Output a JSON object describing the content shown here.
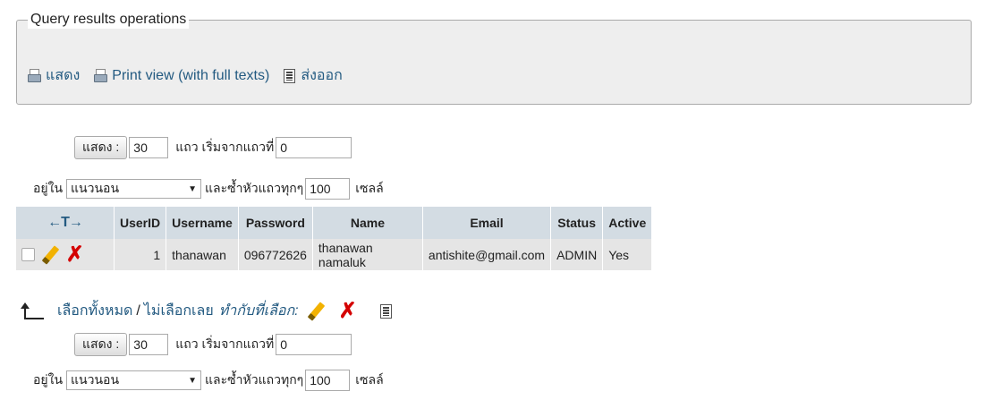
{
  "ops": {
    "legend": "Query results operations",
    "show_label": "แสดง",
    "print_label": "Print view (with full texts)",
    "export_label": "ส่งออก"
  },
  "nav": {
    "show_button": "แสดง :",
    "rows_value": "30",
    "rows_text": "แถว เริ่มจากแถวที่",
    "start_value": "0",
    "in_label": "อยู่ใน",
    "mode_value": "แนวนอน",
    "repeat_text": "และซ้ำหัวแถวทุกๆ",
    "repeat_value": "100",
    "cells_text": "เซลล์"
  },
  "table": {
    "arrows": "←T→",
    "headers": [
      "UserID",
      "Username",
      "Password",
      "Name",
      "Email",
      "Status",
      "Active"
    ],
    "rows": [
      [
        "1",
        "thanawan",
        "096772626",
        "thanawan namaluk",
        "antishite@gmail.com",
        "ADMIN",
        "Yes"
      ]
    ]
  },
  "selection": {
    "select_all": "เลือกทั้งหมด",
    "separator": "/",
    "select_none": "ไม่เลือกเลย",
    "with_selected": "ทำกับที่เลือก:"
  },
  "colors": {
    "link": "#235a81",
    "header_bg": "#d3dce3",
    "row_bg": "#e5e5e5",
    "fieldset_bg": "#eeeeee",
    "delete": "#d40000"
  },
  "icons": [
    "printer-icon",
    "export-icon",
    "pencil-icon",
    "delete-icon",
    "arrow-up-icon"
  ]
}
